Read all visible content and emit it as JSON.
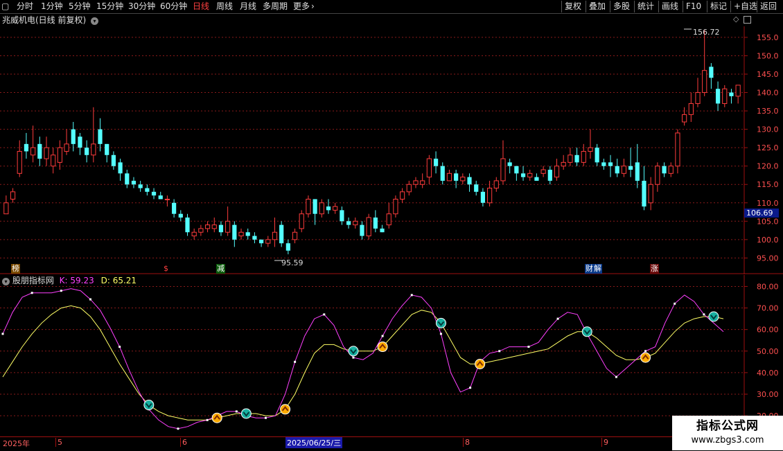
{
  "toolbar": {
    "left": [
      "分时",
      "1分钟",
      "5分钟",
      "15分钟",
      "30分钟",
      "60分钟",
      "日线",
      "周线",
      "月线",
      "多周期",
      "更多"
    ],
    "active": "日线",
    "more_arrow": "›",
    "right": [
      "复权",
      "叠加",
      "多股",
      "统计",
      "画线",
      "F10",
      "标记",
      "+自选",
      "返回"
    ]
  },
  "main_chart": {
    "title": "兆威机电(日线 前复权)",
    "high_label": "156.72",
    "low_label": "95.59",
    "current_price": "106.69",
    "y_ticks": [
      "155.0",
      "150.0",
      "145.0",
      "140.0",
      "135.0",
      "130.0",
      "125.0",
      "120.0",
      "115.0",
      "110.0",
      "105.0",
      "100.0",
      "95.00"
    ],
    "event_markers": [
      "榜",
      "$",
      "减",
      "财",
      "解",
      "涨"
    ]
  },
  "indicator": {
    "name": "股朋指标网",
    "k_label": "K: 59.23",
    "d_label": "D: 65.21",
    "y_ticks": [
      "80.00",
      "70.00",
      "60.00",
      "50.00",
      "40.00",
      "30.00",
      "20.00"
    ]
  },
  "date_axis": {
    "year": "2025年",
    "months": [
      "5",
      "6",
      "8",
      "9"
    ],
    "cursor_date": "2025/06/25/三"
  },
  "watermark": {
    "line1": "指标公式网",
    "line2": "www.zbgs3.com"
  },
  "colors": {
    "up": "#ff3c3c",
    "down": "#54ffff",
    "k": "#ff40ff",
    "d": "#ffff66",
    "grid": "#8b1a1a",
    "bg": "#000000"
  },
  "chart_data": {
    "type": "candlestick",
    "ylim": [
      93,
      158
    ],
    "candles": [
      [
        107,
        110,
        107,
        112
      ],
      [
        111,
        113,
        110,
        114
      ],
      [
        118,
        124,
        117,
        127
      ],
      [
        126,
        124,
        122,
        129
      ],
      [
        123,
        125,
        121,
        131
      ],
      [
        126,
        122,
        120,
        128
      ],
      [
        122,
        125,
        120,
        128
      ],
      [
        120,
        123,
        118,
        125
      ],
      [
        121,
        125,
        119,
        127
      ],
      [
        124,
        126,
        123,
        130
      ],
      [
        130,
        126,
        124,
        132
      ],
      [
        128,
        125,
        123,
        129
      ],
      [
        125,
        123,
        121,
        127
      ],
      [
        123,
        126,
        121,
        136
      ],
      [
        130,
        126,
        124,
        133
      ],
      [
        126,
        123,
        121,
        126
      ],
      [
        123,
        120,
        119,
        124
      ],
      [
        121,
        118,
        116,
        122
      ],
      [
        118,
        115,
        114,
        119
      ],
      [
        116,
        115,
        114,
        117
      ],
      [
        115,
        114,
        113,
        116
      ],
      [
        114,
        113,
        112,
        115
      ],
      [
        113,
        112,
        111,
        114
      ],
      [
        112,
        111,
        111,
        113
      ],
      [
        111,
        111,
        109,
        112
      ],
      [
        110,
        107,
        106,
        111
      ],
      [
        107,
        106,
        105,
        108
      ],
      [
        106,
        102,
        101,
        107
      ],
      [
        101,
        102,
        100,
        103
      ],
      [
        102,
        103,
        101,
        104
      ],
      [
        103,
        104,
        102,
        105
      ],
      [
        103,
        104,
        102,
        106
      ],
      [
        104,
        102,
        101,
        105
      ],
      [
        102,
        105,
        101,
        109
      ],
      [
        104,
        100,
        98,
        105
      ],
      [
        101,
        102,
        100,
        103
      ],
      [
        102,
        101,
        100,
        103
      ],
      [
        101,
        100,
        99,
        102
      ],
      [
        100,
        99,
        98,
        100
      ],
      [
        99,
        100,
        98,
        101
      ],
      [
        100,
        102,
        98,
        106
      ],
      [
        104,
        99,
        98,
        105
      ],
      [
        99,
        97,
        96,
        100
      ],
      [
        100,
        102,
        99,
        103
      ],
      [
        103,
        107,
        102,
        108
      ],
      [
        107,
        111,
        106,
        112
      ],
      [
        111,
        107,
        104,
        111
      ],
      [
        107,
        110,
        106,
        111
      ],
      [
        109,
        108,
        107,
        111
      ],
      [
        108,
        109,
        107,
        110
      ],
      [
        108,
        105,
        104,
        109
      ],
      [
        105,
        104,
        103,
        106
      ],
      [
        104,
        105,
        103,
        106
      ],
      [
        104,
        101,
        100,
        105
      ],
      [
        101,
        106,
        100,
        107
      ],
      [
        106,
        103,
        102,
        108
      ],
      [
        103,
        102,
        102,
        104
      ],
      [
        104,
        107,
        103,
        110
      ],
      [
        107,
        111,
        106,
        112
      ],
      [
        111,
        113,
        110,
        114
      ],
      [
        113,
        115,
        112,
        116
      ],
      [
        115,
        116,
        114,
        117
      ],
      [
        115,
        116,
        114,
        118
      ],
      [
        117,
        122,
        115,
        123
      ],
      [
        122,
        120,
        118,
        124
      ],
      [
        120,
        116,
        115,
        121
      ],
      [
        116,
        118,
        116,
        119
      ],
      [
        118,
        116,
        114,
        119
      ],
      [
        116,
        117,
        115,
        118
      ],
      [
        117,
        115,
        113,
        118
      ],
      [
        115,
        113,
        112,
        116
      ],
      [
        113,
        110,
        109,
        114
      ],
      [
        110,
        114,
        109,
        116
      ],
      [
        114,
        116,
        113,
        117
      ],
      [
        116,
        122,
        115,
        127
      ],
      [
        121,
        120,
        118,
        122
      ],
      [
        120,
        118,
        116,
        120
      ],
      [
        118,
        117,
        116,
        120
      ],
      [
        117,
        118,
        116,
        119
      ],
      [
        117,
        116,
        116,
        118
      ],
      [
        118,
        119,
        117,
        120
      ],
      [
        119,
        116,
        115,
        120
      ],
      [
        117,
        120,
        116,
        122
      ],
      [
        120,
        121,
        119,
        123
      ],
      [
        121,
        123,
        120,
        125
      ],
      [
        123,
        121,
        120,
        125
      ],
      [
        121,
        124,
        120,
        126
      ],
      [
        124,
        125,
        122,
        130
      ],
      [
        125,
        121,
        120,
        126
      ],
      [
        121,
        120,
        119,
        122
      ],
      [
        121,
        120,
        117,
        123
      ],
      [
        120,
        118,
        117,
        122
      ],
      [
        118,
        120,
        117,
        122
      ],
      [
        120,
        119,
        117,
        125
      ],
      [
        121,
        116,
        114,
        126
      ],
      [
        116,
        109,
        108,
        120
      ],
      [
        110,
        115,
        108,
        117
      ],
      [
        115,
        120,
        113,
        121
      ],
      [
        120,
        118,
        117,
        121
      ],
      [
        118,
        120,
        117,
        121
      ],
      [
        120,
        129,
        118,
        130
      ],
      [
        132,
        134,
        131,
        136
      ],
      [
        134,
        137,
        132,
        140
      ],
      [
        137,
        140,
        136,
        144
      ],
      [
        140,
        146,
        139,
        157
      ],
      [
        147,
        144,
        141,
        148
      ],
      [
        141,
        137,
        135,
        143
      ],
      [
        137,
        141,
        136,
        142
      ],
      [
        140,
        139,
        137,
        141
      ],
      [
        139,
        142,
        137,
        142
      ]
    ],
    "k_series": [
      58,
      68,
      75,
      77,
      77,
      77,
      78,
      79,
      78,
      74,
      69,
      61,
      52,
      41,
      31,
      23,
      18,
      15,
      14,
      15,
      17,
      18,
      20,
      22,
      22,
      20,
      19,
      19,
      20,
      30,
      45,
      57,
      65,
      67,
      62,
      52,
      47,
      46,
      49,
      57,
      65,
      71,
      76,
      75,
      70,
      58,
      40,
      31,
      33,
      45,
      49,
      50,
      52,
      52,
      52,
      54,
      60,
      65,
      68,
      67,
      58,
      50,
      42,
      38,
      42,
      46,
      50,
      52,
      63,
      72,
      76,
      73,
      67,
      63,
      59
    ],
    "d_series": [
      38,
      45,
      52,
      58,
      63,
      67,
      70,
      71,
      70,
      66,
      60,
      52,
      44,
      37,
      30,
      25,
      22,
      20,
      19,
      18,
      18,
      18,
      19,
      20,
      21,
      21,
      21,
      20,
      20,
      23,
      30,
      40,
      49,
      53,
      53,
      51,
      50,
      50,
      50,
      52,
      57,
      62,
      67,
      69,
      68,
      63,
      55,
      47,
      44,
      44,
      45,
      46,
      47,
      48,
      49,
      50,
      51,
      54,
      57,
      59,
      59,
      56,
      52,
      48,
      46,
      46,
      47,
      49,
      54,
      59,
      63,
      65,
      66,
      66,
      65
    ],
    "k_ylim": [
      12,
      84
    ]
  }
}
